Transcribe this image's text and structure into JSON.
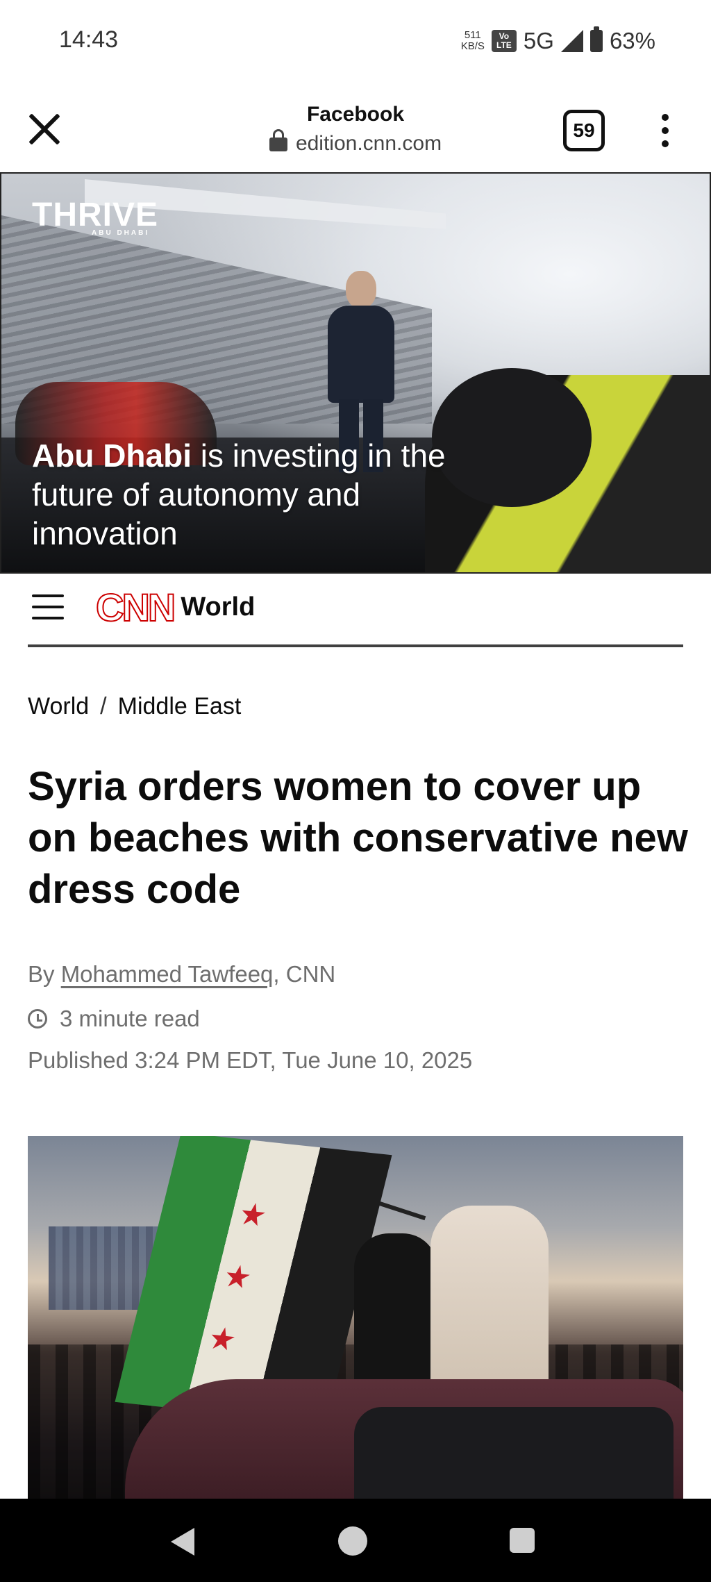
{
  "status_bar": {
    "time": "14:43",
    "speed_value": "511",
    "speed_unit": "KB/S",
    "volte_top": "Vo",
    "volte_bottom": "LTE",
    "network": "5G",
    "battery": "63%"
  },
  "browser": {
    "title": "Facebook",
    "url": "edition.cnn.com",
    "tab_count": "59"
  },
  "ad": {
    "brand": "THRIVE",
    "brand_sub": "ABU DHABI",
    "headline_bold": "Abu Dhabi",
    "headline_rest": " is investing in the future of autonomy and innovation"
  },
  "site_header": {
    "logo": "CNN",
    "section": "World"
  },
  "breadcrumb": {
    "items": [
      "World",
      "Middle East"
    ],
    "separator": "/"
  },
  "article": {
    "headline": "Syria orders women to cover up on beaches with conservative new dress code",
    "byline_prefix": "By ",
    "author": "Mohammed Tawfeeq",
    "byline_suffix": ", CNN",
    "read_time": "3 minute read",
    "published": "Published 3:24 PM EDT, Tue June 10, 2025"
  },
  "colors": {
    "cnn_red": "#cc0000",
    "meta_gray": "#6e6e6e"
  }
}
